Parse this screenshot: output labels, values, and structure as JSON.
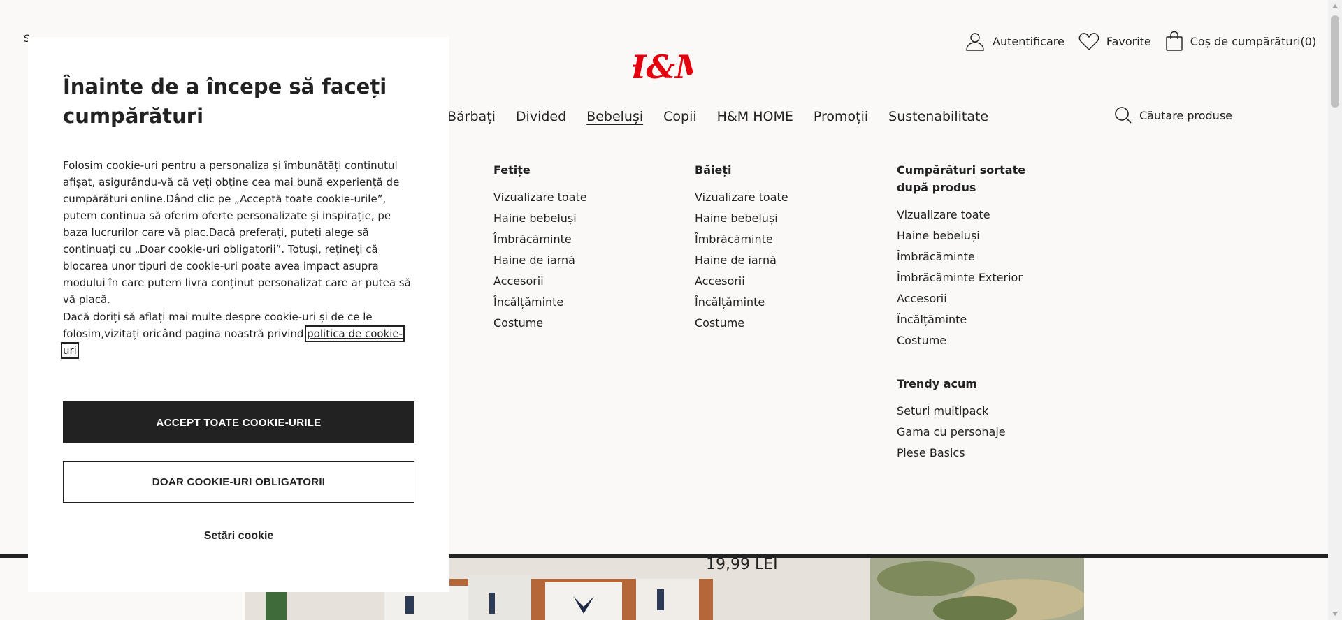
{
  "header": {
    "top_left_letter": "S",
    "login_label": "Autentificare",
    "favorites_label": "Favorite",
    "cart_label": "Coș de cumpărături(0)",
    "logo_text": "H&M",
    "search_placeholder": "Căutare produse"
  },
  "nav": {
    "items": [
      {
        "label": "Bărbați"
      },
      {
        "label": "Divided"
      },
      {
        "label": "Bebeluși"
      },
      {
        "label": "Copii"
      },
      {
        "label": "H&M HOME"
      },
      {
        "label": "Promoții"
      },
      {
        "label": "Sustenabilitate"
      }
    ],
    "active": "Bebeluși"
  },
  "dropdown": {
    "girls": {
      "title": "Fetițe",
      "items": [
        "Vizualizare toate",
        "Haine bebeluși",
        "Îmbrăcăminte",
        "Haine de iarnă",
        "Accesorii",
        "Încălțăminte",
        "Costume"
      ]
    },
    "boys": {
      "title": "Băieți",
      "items": [
        "Vizualizare toate",
        "Haine bebeluși",
        "Îmbrăcăminte",
        "Haine de iarnă",
        "Accesorii",
        "Încălțăminte",
        "Costume"
      ]
    },
    "by_product": {
      "title": "Cumpărături sortate după produs",
      "items": [
        "Vizualizare toate",
        "Haine bebeluși",
        "Îmbrăcăminte",
        "Îmbrăcăminte Exterior",
        "Accesorii",
        "Încălțăminte",
        "Costume"
      ]
    },
    "trending": {
      "title": "Trendy acum",
      "items": [
        "Seturi multipack",
        "Gama cu personaje",
        "Piese Basics"
      ]
    }
  },
  "banner": {
    "price": "19,99 LEI"
  },
  "cookie": {
    "title": "Înainte de a începe să faceți cumpărături",
    "body": "Folosim cookie-uri pentru a personaliza și îmbunătăți conținutul afișat, asigurându-vă că veți obține cea mai bună experiență de cumpărături online.Dând clic pe „Acceptă toate cookie-urile”, putem continua să oferim oferte personalizate și inspirație, pe baza lucrurilor care vă plac.Dacă preferați, puteți alege să continuați cu „Doar cookie-uri obligatorii”. Totuși, rețineți că blocarea unor tipuri de cookie-uri poate avea impact asupra modului în care putem livra conținut personalizat care ar putea să vă placă.",
    "more_info": "Dacă doriți să aflați mai multe despre cookie-uri și de ce le folosim,vizitați oricând pagina noastră privind ",
    "policy_link": "politica de cookie-uri",
    "period": ".",
    "accept_all": "ACCEPT TOATE COOKIE-URILE",
    "required_only": "DOAR COOKIE-URI OBLIGATORII",
    "settings": "Setări cookie"
  },
  "colors": {
    "brand_red": "#e50010",
    "dark": "#222222",
    "background": "#faf9f8"
  }
}
